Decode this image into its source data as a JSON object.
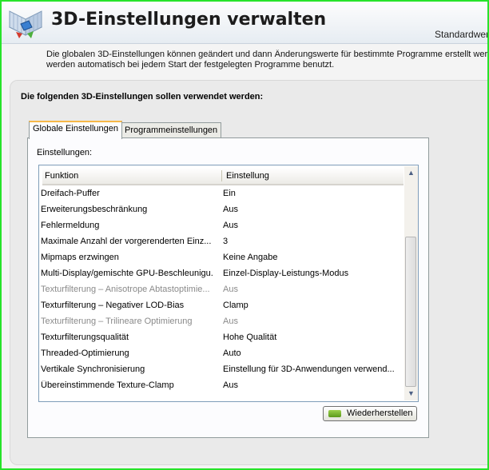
{
  "header": {
    "title": "3D-Einstellungen verwalten",
    "restore_link": "Standardwer"
  },
  "description": {
    "line1": "Die globalen 3D-Einstellungen können geändert und dann Änderungswerte für bestimmte Programme erstellt werden.",
    "line2": "werden automatisch bei jedem Start der festgelegten Programme benutzt."
  },
  "section_heading": "Die folgenden 3D-Einstellungen sollen verwendet werden:",
  "tabs": [
    {
      "label": "Globale Einstellungen",
      "active": true
    },
    {
      "label": "Programmeinstellungen",
      "active": false
    }
  ],
  "settings_label": "Einstellungen:",
  "table": {
    "columns": [
      "Funktion",
      "Einstellung"
    ],
    "rows": [
      {
        "function": "Dreifach-Puffer",
        "setting": "Ein",
        "enabled": true
      },
      {
        "function": "Erweiterungsbeschränkung",
        "setting": "Aus",
        "enabled": true
      },
      {
        "function": "Fehlermeldung",
        "setting": "Aus",
        "enabled": true
      },
      {
        "function": "Maximale Anzahl der vorgerenderten Einz...",
        "setting": "3",
        "enabled": true
      },
      {
        "function": "Mipmaps erzwingen",
        "setting": "Keine Angabe",
        "enabled": true
      },
      {
        "function": "Multi-Display/gemischte GPU-Beschleunigu...",
        "setting": "Einzel-Display-Leistungs-Modus",
        "enabled": true
      },
      {
        "function": "Texturfilterung – Anisotrope Abtastoptimie...",
        "setting": "Aus",
        "enabled": false
      },
      {
        "function": "Texturfilterung – Negativer LOD-Bias",
        "setting": "Clamp",
        "enabled": true
      },
      {
        "function": "Texturfilterung – Trilineare Optimierung",
        "setting": "Aus",
        "enabled": false
      },
      {
        "function": "Texturfilterungsqualität",
        "setting": "Hohe Qualität",
        "enabled": true
      },
      {
        "function": "Threaded-Optimierung",
        "setting": "Auto",
        "enabled": true
      },
      {
        "function": "Vertikale Synchronisierung",
        "setting": "Einstellung für 3D-Anwendungen verwend...",
        "enabled": true
      },
      {
        "function": "Übereinstimmende Texture-Clamp",
        "setting": "Aus",
        "enabled": true
      }
    ]
  },
  "restore_button": {
    "label": "Wiederherstellen",
    "icon": "nvidia-icon"
  },
  "icons": {
    "logo": "nvidia-3d-settings-icon",
    "scroll_up": "scroll-up-icon",
    "scroll_down": "scroll-down-icon"
  },
  "colors": {
    "frame": "#27e32a",
    "tab_highlight": "#f7b848",
    "disabled_text": "#8a8a8a"
  }
}
